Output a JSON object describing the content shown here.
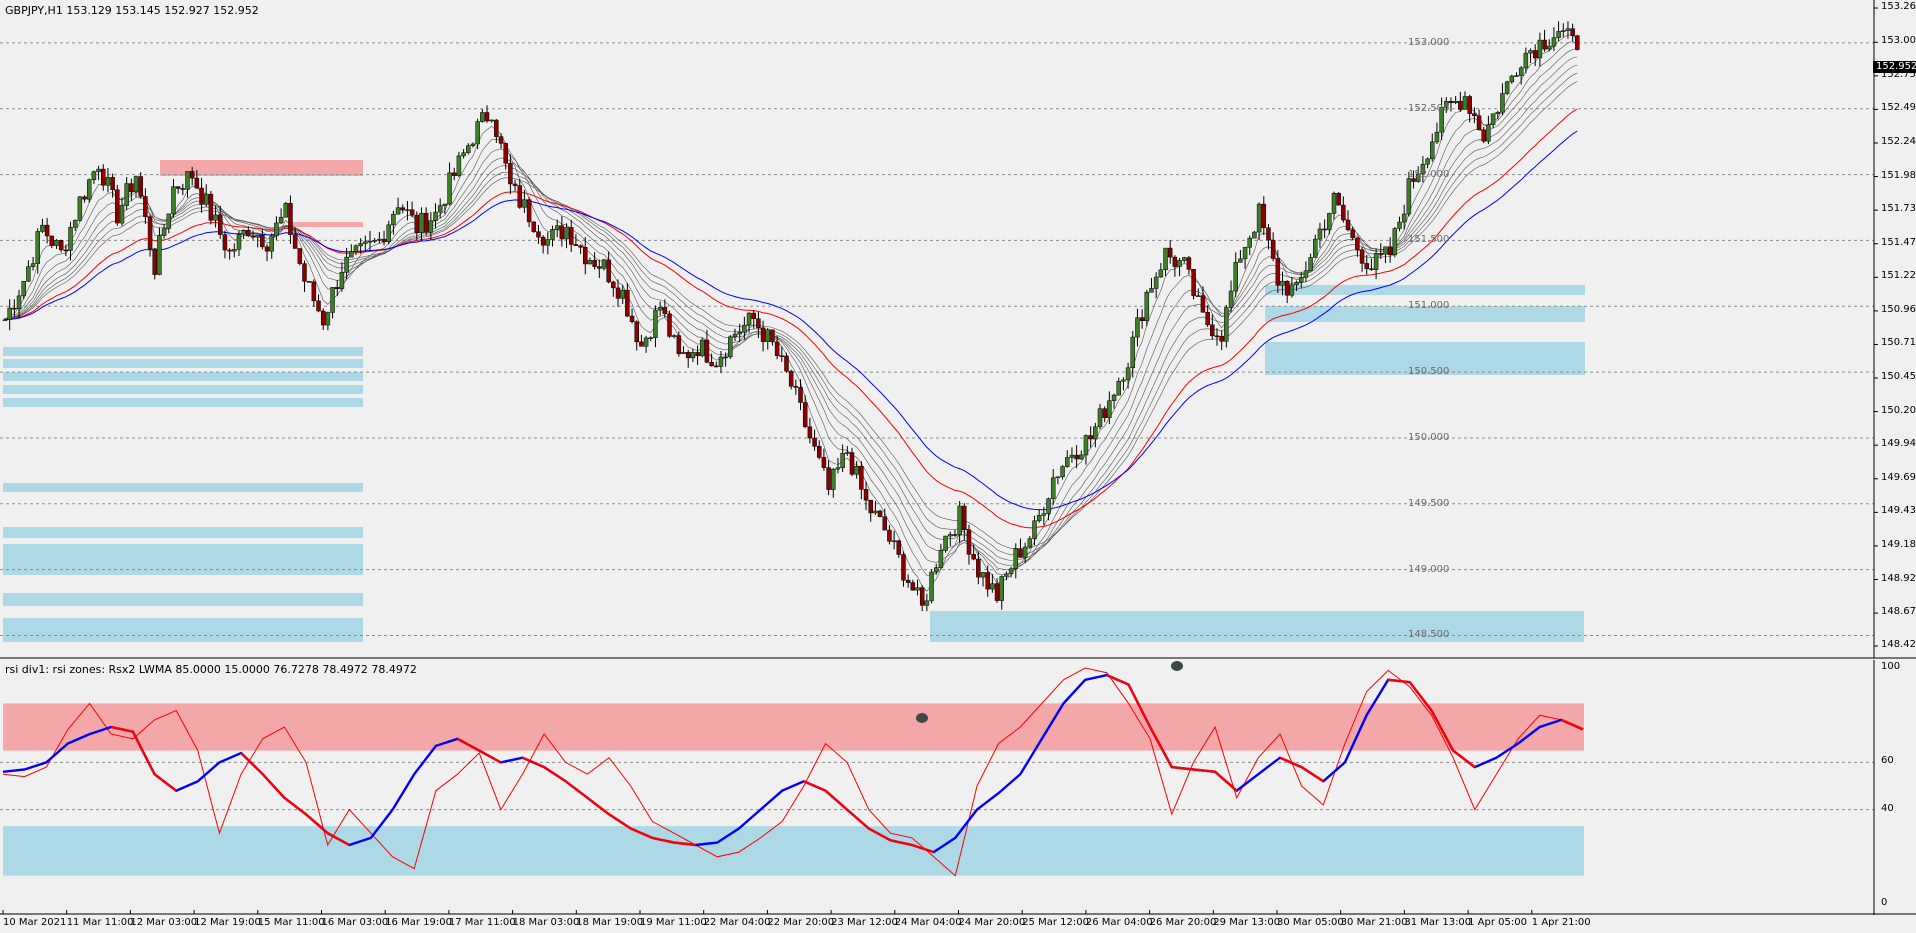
{
  "header": {
    "symbol_line": "GBPJPY,H1  153.129 153.145 152.927 152.952",
    "indicator_line": "rsi div1: rsi zones: Rsx2 LWMA 85.0000 15.0000 76.7278 78.4972 78.4972"
  },
  "current_price": "152.952",
  "chart_data": [
    {
      "type": "candlestick",
      "title": "GBPJPY,H1",
      "ohlc": {
        "open": "153.129",
        "high": "153.145",
        "low": "152.927",
        "close": "152.952"
      },
      "ylim": [
        148.42,
        153.25
      ],
      "y_ticks": [
        "153.265",
        "153.005",
        "152.750",
        "152.495",
        "152.240",
        "151.985",
        "151.730",
        "151.475",
        "151.220",
        "150.965",
        "150.710",
        "150.455",
        "150.200",
        "149.945",
        "149.690",
        "149.435",
        "149.180",
        "148.925",
        "148.670",
        "148.420"
      ],
      "levels": [
        "153.000",
        "152.500",
        "152.000",
        "151.500",
        "151.000",
        "150.500",
        "150.000",
        "149.500",
        "149.000",
        "148.500"
      ],
      "x_ticks": [
        "10 Mar 2021",
        "11 Mar 11:00",
        "12 Mar 03:00",
        "12 Mar 19:00",
        "15 Mar 11:00",
        "16 Mar 03:00",
        "16 Mar 19:00",
        "17 Mar 11:00",
        "18 Mar 03:00",
        "18 Mar 19:00",
        "19 Mar 11:00",
        "22 Mar 04:00",
        "22 Mar 20:00",
        "23 Mar 12:00",
        "24 Mar 04:00",
        "24 Mar 20:00",
        "25 Mar 12:00",
        "26 Mar 04:00",
        "26 Mar 20:00",
        "29 Mar 13:00",
        "30 Mar 05:00",
        "30 Mar 21:00",
        "31 Mar 13:00",
        "1 Apr 05:00",
        "1 Apr 21:00"
      ],
      "close_path": [
        150.9,
        151.2,
        151.6,
        151.4,
        151.8,
        152.1,
        151.7,
        152.0,
        151.3,
        151.9,
        152.0,
        151.7,
        151.4,
        151.6,
        151.5,
        151.7,
        151.2,
        150.9,
        151.3,
        151.4,
        151.5,
        151.8,
        151.6,
        151.7,
        152.0,
        152.3,
        152.5,
        151.9,
        151.7,
        151.5,
        151.6,
        151.4,
        151.3,
        151.1,
        150.7,
        151.0,
        150.6,
        150.7,
        150.6,
        150.8,
        150.9,
        150.7,
        150.4,
        150.0,
        149.6,
        149.9,
        149.5,
        149.3,
        149.0,
        148.7,
        149.2,
        149.4,
        149.0,
        148.8,
        149.1,
        149.3,
        149.7,
        149.9,
        150.0,
        150.3,
        150.6,
        151.1,
        151.4,
        151.3,
        150.9,
        150.8,
        151.4,
        151.7,
        151.2,
        151.1,
        151.5,
        151.8,
        151.5,
        151.3,
        151.4,
        151.9,
        152.2,
        152.5,
        152.6,
        152.3,
        152.6,
        152.9,
        153.0,
        153.1,
        152.95
      ],
      "ma_bands": {
        "colors": [
          "#0000ff",
          "#ff0000",
          "#000000"
        ]
      },
      "zones": [
        {
          "color": "#f4a7a9",
          "from": 152.2,
          "to": 152.23,
          "range": "left"
        },
        {
          "color": "#add8e6",
          "from": 148.4,
          "to": 148.65,
          "range": "right"
        }
      ]
    },
    {
      "type": "line",
      "title": "rsi div1: rsi zones: Rsx2 LWMA 85.0000 15.0000 76.7278 78.4972 78.4972",
      "ylim": [
        0,
        100
      ],
      "y_ticks": [
        "100",
        "60",
        "40",
        "0"
      ],
      "levels": [
        60,
        40
      ],
      "zones": [
        {
          "color": "#f4a7a9",
          "from": 65,
          "to": 85
        },
        {
          "color": "#add8e6",
          "from": 12,
          "to": 33
        }
      ],
      "series": [
        {
          "values": [
            55,
            54,
            58,
            74,
            85,
            72,
            70,
            78,
            82,
            65,
            30,
            55,
            70,
            75,
            60,
            25,
            40,
            30,
            20,
            15,
            48,
            55,
            64,
            40,
            55,
            72,
            60,
            55,
            62,
            50,
            35,
            30,
            25,
            20,
            22,
            28,
            35,
            50,
            68,
            60,
            40,
            30,
            28,
            20,
            12,
            50,
            68,
            75,
            85,
            95,
            100,
            98,
            85,
            70,
            38,
            60,
            75,
            45,
            62,
            72,
            50,
            42,
            68,
            90,
            99,
            92,
            80,
            62,
            40,
            55,
            70,
            80,
            78,
            74
          ]
        },
        {
          "values": [
            56,
            57,
            60,
            68,
            72,
            75,
            73,
            55,
            48,
            52,
            60,
            64,
            55,
            45,
            38,
            30,
            25,
            28,
            40,
            55,
            67,
            70,
            65,
            60,
            62,
            58,
            52,
            45,
            38,
            32,
            28,
            26,
            25,
            26,
            32,
            40,
            48,
            52,
            48,
            40,
            32,
            27,
            25,
            22,
            28,
            40,
            47,
            55,
            70,
            85,
            95,
            97,
            93,
            75,
            58,
            57,
            56,
            48,
            55,
            62,
            58,
            52,
            60,
            80,
            95,
            94,
            82,
            65,
            58,
            62,
            68,
            75,
            78,
            74
          ]
        }
      ]
    }
  ]
}
